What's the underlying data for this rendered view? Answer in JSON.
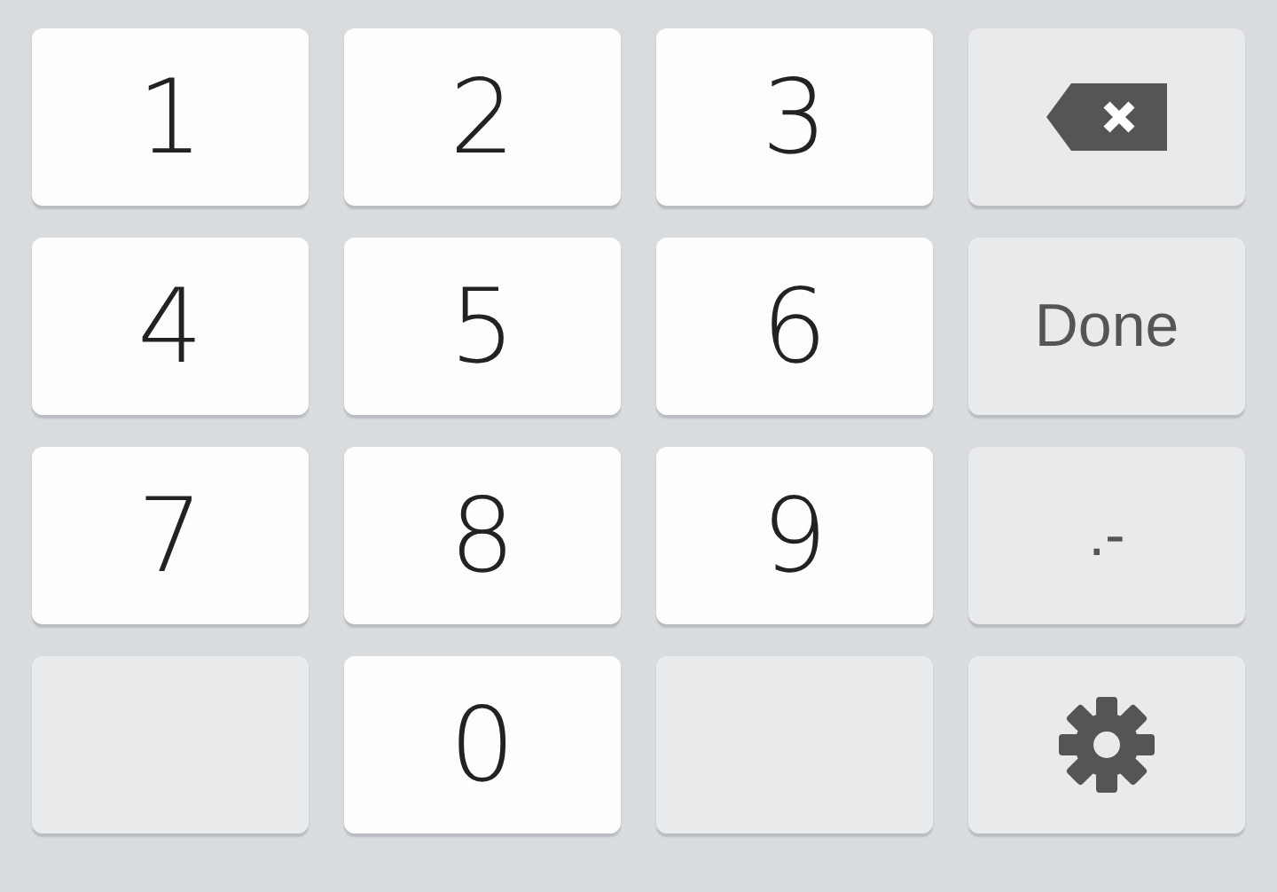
{
  "keys": [
    {
      "kind": "digit",
      "label": "1"
    },
    {
      "kind": "digit",
      "label": "2"
    },
    {
      "kind": "digit",
      "label": "3"
    },
    {
      "kind": "backspace"
    },
    {
      "kind": "digit",
      "label": "4"
    },
    {
      "kind": "digit",
      "label": "5"
    },
    {
      "kind": "digit",
      "label": "6"
    },
    {
      "kind": "action",
      "label": "Done"
    },
    {
      "kind": "digit",
      "label": "7"
    },
    {
      "kind": "digit",
      "label": "8"
    },
    {
      "kind": "digit",
      "label": "9"
    },
    {
      "kind": "symbol",
      "label": ".-"
    },
    {
      "kind": "blank"
    },
    {
      "kind": "digit",
      "label": "0"
    },
    {
      "kind": "blank"
    },
    {
      "kind": "settings"
    }
  ]
}
